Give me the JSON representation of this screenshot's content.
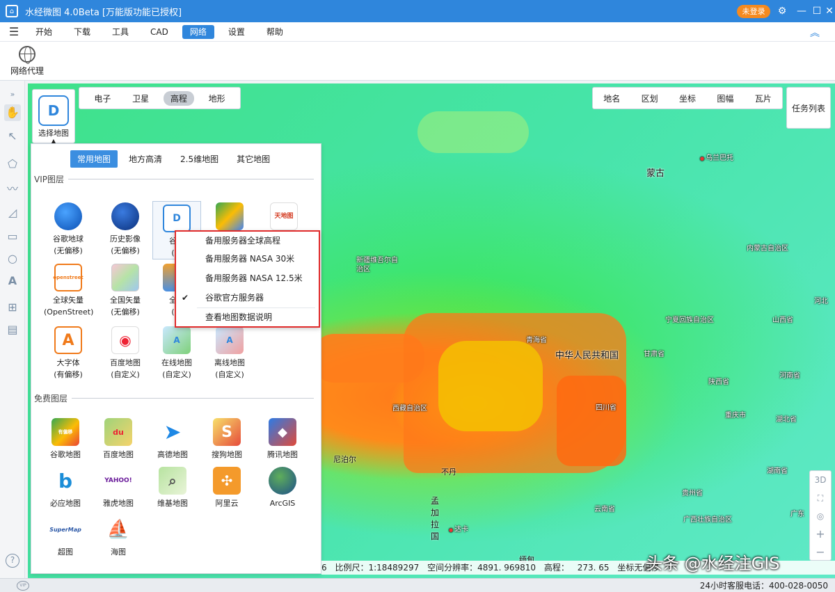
{
  "app": {
    "title": "水经微图 4.0Beta [万能版功能已授权]",
    "login_label": "未登录"
  },
  "window_controls": {
    "settings": "⚙",
    "minimize": "—",
    "maximize": "☐",
    "close": "✕"
  },
  "menu": [
    "开始",
    "下载",
    "工具",
    "CAD",
    "网络",
    "设置",
    "帮助"
  ],
  "menu_active": "网络",
  "ribbon": {
    "proxy_label": "网络代理"
  },
  "map_types": [
    "电子",
    "卫星",
    "高程",
    "地形"
  ],
  "map_type_active": "高程",
  "layer_toggles": [
    "地名",
    "区划",
    "坐标",
    "图幅",
    "瓦片"
  ],
  "task_list_label": "任务列表",
  "select_map_label": "选择地图",
  "panel": {
    "tabs": [
      "常用地图",
      "地方高清",
      "2.5维地图",
      "其它地图"
    ],
    "active_tab": "常用地图",
    "vip_section": "VIP图层",
    "free_section": "免费图层",
    "vip_tiles": [
      {
        "l1": "谷歌地球",
        "l2": "(无偏移)"
      },
      {
        "l1": "历史影像",
        "l2": "(无偏移)"
      },
      {
        "l1": "谷歌",
        "l2": "(等"
      },
      {
        "l1": "",
        "l2": ""
      },
      {
        "l1": "",
        "l2": ""
      },
      {
        "l1": "全球矢量",
        "l2": "(OpenStreet)"
      },
      {
        "l1": "全国矢量",
        "l2": "(无偏移)"
      },
      {
        "l1": "全国",
        "l2": "(含"
      },
      {
        "l1": "大字体",
        "l2": "(有偏移)"
      },
      {
        "l1": "百度地图",
        "l2": "(自定义)"
      },
      {
        "l1": "在线地图",
        "l2": "(自定义)"
      },
      {
        "l1": "离线地图",
        "l2": "(自定义)"
      }
    ],
    "free_tiles": [
      "谷歌地图",
      "百度地图",
      "高德地图",
      "搜狗地图",
      "腾讯地图",
      "必应地图",
      "雅虎地图",
      "维基地图",
      "阿里云",
      "ArcGIS",
      "超图",
      "海图"
    ],
    "icon_text": {
      "openstreet": "openstreet",
      "tianditu": "天地图",
      "du": "du",
      "yahoo": "YAHOO!",
      "supermap": "SuperMap",
      "youpianyi": "有偏移"
    }
  },
  "context_menu": {
    "items": [
      "备用服务器全球高程",
      "备用服务器 NASA 30米",
      "备用服务器 NASA 12.5米",
      "谷歌官方服务器",
      "查看地图数据说明"
    ],
    "checked_index": 3,
    "check_glyph": "✔"
  },
  "map_labels": {
    "mongolia": "蒙古",
    "ulaanbaatar": "乌兰巴托",
    "neimenggu": "内蒙古自治区",
    "xinjiang": "新疆维吾尔自治区",
    "qinghai": "青海省",
    "ningxia": "宁夏回族自治区",
    "shanxi": "山西省",
    "hebei": "河北",
    "china": "中华人民共和国",
    "gansu": "甘肃省",
    "shaanxi": "陕西省",
    "henan": "河南省",
    "tibet": "西藏自治区",
    "sichuan": "四川省",
    "chongqing": "重庆市",
    "hubei": "湖北省",
    "nepal": "尼泊尔",
    "bhutan": "不丹",
    "hunan": "湖南省",
    "guizhou": "贵州省",
    "yunnan": "云南省",
    "guangxi": "广西壮族自治区",
    "guangdong": "广东",
    "bangladesh": "孟加拉国",
    "dhaka": "达卡",
    "myanmar": "缅甸",
    "ghost1": "新疆",
    "ghost2": "拉"
  },
  "nav_tools": [
    "3D",
    "⛶",
    "◎",
    "+",
    "−"
  ],
  "status": {
    "level": "6",
    "scale": "比例尺：1:18489297",
    "resolution": "空间分辨率：4891. 969810",
    "elevation_label": "高程：",
    "elevation_value": "273. 65",
    "coord_note": "坐标无偏移"
  },
  "watermark": "头条 @水经注GIS",
  "hotline": "24小时客服电话：400-028-0050",
  "help_glyph": "?",
  "vip_badge": "VIP"
}
